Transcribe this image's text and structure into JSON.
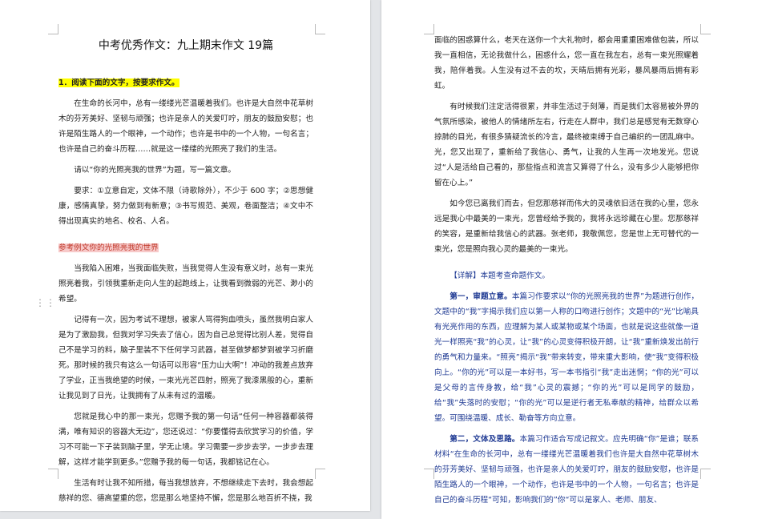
{
  "document": {
    "title": "中考优秀作文：九上期末作文 19篇"
  },
  "left_page": {
    "question_label": "1．阅读下面的文字，按要求作文。",
    "paragraphs": [
      "在生命的长河中，总有一缕缕光芒温暖着我们。也许是大自然中花草树木的芬芳美好、坚韧与顽强；也许是亲人的关爱叮咛，朋友的鼓励安慰；也许是陌生路人的一个眼神，一个动作；也许是书中的一个人物，一句名言；也许是自己的奋斗历程……就是这一缕缕的光照亮了我们的生活。",
      "请以“你的光照亮我的世界”为题，写一篇文章。",
      "要求：①立意自定，文体不限（诗歌除外），不少于 600 字；②思想健康，感情真挚，努力做到有新意；③书写规范、美观，卷面整洁；④文中不得出现真实的地名、校名、人名。"
    ],
    "example_label": "参考例文",
    "example_title": "你的光照亮我的世界",
    "essay": [
      "当我陷入困难，当我面临失败，当我觉得人生没有意义时，总有一束光照亮着我，引领我重新走向人生的起跑线上，让我看到微弱的光芒、渺小的希望。",
      "记得有一次，因为考试不理想，被家人骂得狗血喷头，虽然我明白家人是为了激励我，但我对学习失去了信心，因为自己总觉得比别人差，觉得自己不是学习的料，脑子里装不下任何学习武器，甚至做梦都梦到被学习折磨死。那时候的我只有这么一句话可以形容“压力山大啊”！冲动的我差点放弃了学业，正当我绝望的时候，一束光光芒四射，照亮了我漆黑般的心，重新让我见到了日光，让我拥有了从未有过的温暖。",
      "您就是我心中的那一束光，您赠予我的第一句话“任何一种容器都装得满，唯有知识的容器大无边”，您还说过：“你要懂得去欣赏学习的价值，学习不可能一下子装到脑子里，学无止境。学习需要一步步去学，一步步去理解，这样才能学到更多。”您赠予我的每一句话，我都铭记在心。",
      "生活有时让我不知所措，每当我想放弃，不想继续走下去时，我会想起慈祥的您、德高望重的您，您是那么地坚持不懈，您是那么地百折不挠，我"
    ]
  },
  "right_page": {
    "paragraphs": [
      "面临的困惑算什么，老天在送你一个大礼物时，都会用重重困难做包装，所以我一直相信，无论我做什么，困惑什么，您一直在我左右，总有一束光照耀着我，陪伴着我。人生没有过不去的坎，天晴后拥有光彩，暴风暴雨后拥有彩虹。",
      "有时候我们注定活得很累，并非生活过于刻薄，而是我们太容易被外界的气氛所感染，被他人的情绪所左右，行走在人群中，我们总是感觉有无数穿心掠肺的目光，有很多猜疑流长的冷言，最终被束缚于自己编织的一团乱麻中。光，您又出现了，重新给了我信心、勇气，让我的人生再一次地发光。您说过“人是活给自己看的，那些指点和流言又算得了什么，没有多少人能够把你留在心上。”",
      "如今您已离我们而去，但您那慈祥而伟大的灵魂依旧活在我的心里，您永远是我心中最美的一束光，您曾经给予我的，我将永远珍藏在心里。您那慈祥的笑容，是重新给我信心的武器。张老师，我敬佩您，您是世上无可替代的一束光，您是照向我心灵的最美的一束光。"
    ],
    "analysis_label": "【详解】本题考查命题作文。",
    "analysis": [
      {
        "lead": "第一，审题立意。",
        "text": "本篇习作要求以“你的光照亮我的世界”为题进行创作，文题中的“我”字揭示我们应以第一人称的口吻进行创作；文题中的“光”比喻具有光亮作用的东西，应理解为某人或某物或某个场面，也就是说这些就像一道光一样照亮“我”的心灵，让“我”的心灵变得积极开朗，让“我”重新焕发出前行的勇气和力量来。“照亮”揭示“我”带来转变，带来重大影响，使“我”变得积极向上。“你的光”可以是一本好书，写一本书指引“我”走出迷惘；“你的光”可以是父母的言传身教，给“我”心灵的震撼；“你的光”可以是同学的鼓励，给“我”失落时的安慰；“你的光”可以是逆行者无私奉献的精神，给群众以希望。可围绕温暖、成长、勒奋等方向立意。"
      },
      {
        "lead": "第二，文体及思路。",
        "text": "本篇习作适合写成记叙文。应先明确“你”是谁；联系材料“在生命的长河中，总有一缕缕光芒温暖着我们也许是大自然中花草树木的芬芳美好、坚韧与顽强，也许是亲人的关爱叮咛，朋友的鼓励安慰，也许是陌生路人的一个眼神，一个动作，也许是书中的一个人物，一句名言；也许是自己的奋斗历程“可知，影响我们的”你“可以是家人、老师、朋友、"
      }
    ]
  }
}
